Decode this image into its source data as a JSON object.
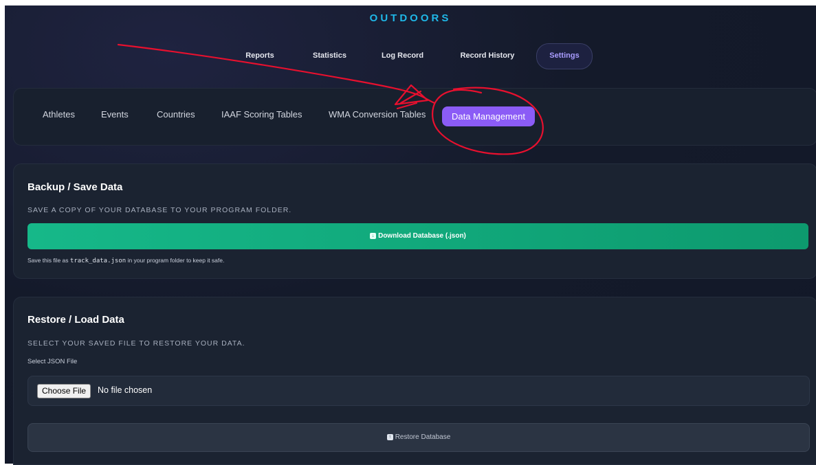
{
  "app": {
    "title": "OUTDOORS"
  },
  "main_nav": {
    "items": [
      {
        "label": "Reports"
      },
      {
        "label": "Statistics"
      },
      {
        "label": "Log Record"
      },
      {
        "label": "Record History"
      },
      {
        "label": "Settings",
        "active": true
      }
    ]
  },
  "settings_tabs": {
    "items": [
      {
        "label": "Athletes"
      },
      {
        "label": "Events"
      },
      {
        "label": "Countries"
      },
      {
        "label": "IAAF Scoring Tables"
      },
      {
        "label": "WMA Conversion Tables"
      },
      {
        "label": "Data Management",
        "active": true
      }
    ]
  },
  "backup": {
    "title": "Backup / Save Data",
    "description": "SAVE A COPY OF YOUR DATABASE TO YOUR PROGRAM FOLDER.",
    "button_label": "Download Database (.json)",
    "note_prefix": "Save this file as",
    "note_filename": "track_data.json",
    "note_suffix": "in your program folder to keep it safe."
  },
  "restore": {
    "title": "Restore / Load Data",
    "description": "SELECT YOUR SAVED FILE TO RESTORE YOUR DATA.",
    "field_label": "Select JSON File",
    "choose_button": "Choose File",
    "file_status": "No file chosen",
    "button_label": "Restore Database"
  },
  "colors": {
    "accent_title": "#1fb8e8",
    "active_tab": "#8b5cf6",
    "download_button": "#13a97c",
    "annotation": "#e8102e"
  },
  "icons": {
    "download": "download-icon",
    "restore": "upload-icon"
  }
}
